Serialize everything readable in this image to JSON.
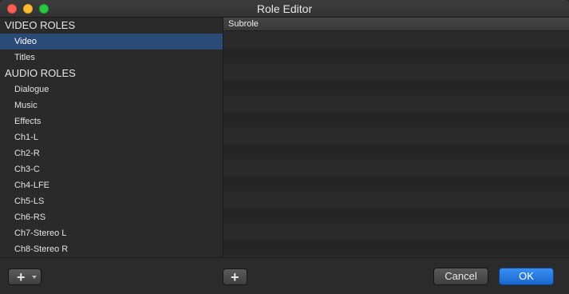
{
  "window": {
    "title": "Role Editor"
  },
  "video_roles": {
    "header": "VIDEO ROLES",
    "items": [
      {
        "label": "Video",
        "selected": true
      },
      {
        "label": "Titles",
        "selected": false
      }
    ]
  },
  "audio_roles": {
    "header": "AUDIO ROLES",
    "items": [
      {
        "label": "Dialogue"
      },
      {
        "label": "Music"
      },
      {
        "label": "Effects"
      },
      {
        "label": "Ch1-L"
      },
      {
        "label": "Ch2-R"
      },
      {
        "label": "Ch3-C"
      },
      {
        "label": "Ch4-LFE"
      },
      {
        "label": "Ch5-LS"
      },
      {
        "label": "Ch6-RS"
      },
      {
        "label": "Ch7-Stereo L"
      },
      {
        "label": "Ch8-Stereo R"
      }
    ]
  },
  "subrole_table": {
    "column_header": "Subrole",
    "rows": []
  },
  "footer": {
    "cancel_label": "Cancel",
    "ok_label": "OK"
  },
  "colors": {
    "selection": "#2a4a78",
    "ok_button": "#1a66d0"
  }
}
